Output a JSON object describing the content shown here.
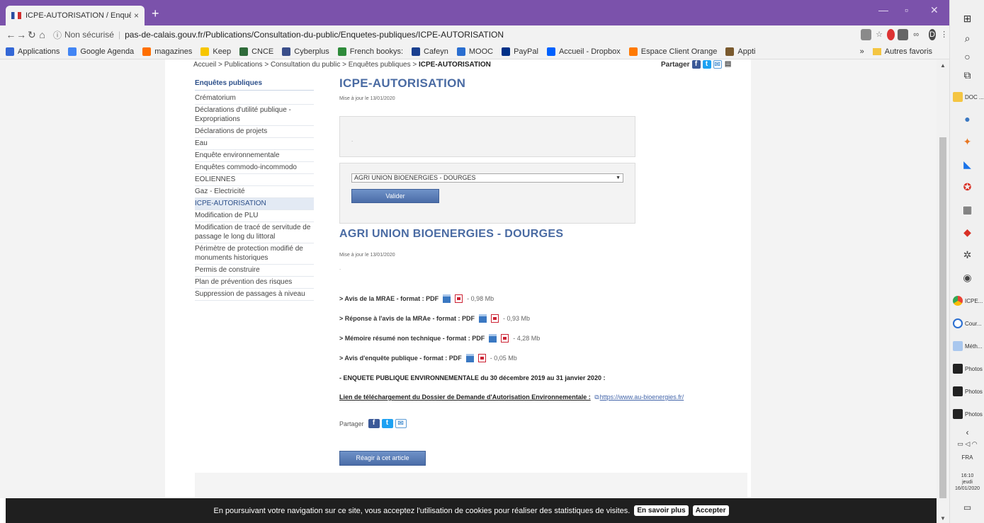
{
  "browser": {
    "tab_title": "ICPE-AUTORISATION / Enquêtes p",
    "tab_close": "×",
    "new_tab": "+",
    "address_security": "Non sécurisé",
    "address_url": "pas-de-calais.gouv.fr/Publications/Consultation-du-public/Enquetes-publiques/ICPE-AUTORISATION",
    "profile_letter": "D"
  },
  "bookmarks": {
    "items": [
      "Applications",
      "Google Agenda",
      "magazines",
      "Keep",
      "CNCE",
      "Cyberplus",
      "French bookys:",
      "Cafeyn",
      "MOOC",
      "PayPal",
      "Accueil - Dropbox",
      "Espace Client Orange",
      "Appti"
    ],
    "more": "»",
    "other": "Autres favoris"
  },
  "page": {
    "breadcrumb_trail": "Accueil > Publications > Consultation du public > Enquêtes publiques > ",
    "breadcrumb_current": "ICPE-AUTORISATION",
    "share_label": "Partager",
    "sidebar": {
      "title": "Enquêtes publiques",
      "items": [
        "Crématorium",
        "Déclarations d'utilité publique - Expropriations",
        "Déclarations de projets",
        "Eau",
        "Enquête environnementale",
        "Enquêtes commodo-incommodo",
        "EOLIENNES",
        "Gaz - Electricité",
        "ICPE-AUTORISATION",
        "Modification de PLU",
        "Modification de tracé de servitude de passage le long du littoral",
        "Périmètre de protection modifié de monuments historiques",
        "Permis de construire",
        "Plan de prévention des risques",
        "Suppression de passages à niveau"
      ],
      "active_index": 8
    },
    "heading": "ICPE-AUTORISATION",
    "updated": "Mise à jour le 13/01/2020",
    "greybox_text": ".",
    "select_value": "AGRI UNION BIOENERGIES - DOURGES",
    "select_arrow": "▼",
    "validate_label": "Valider",
    "subheading": "AGRI UNION BIOENERGIES - DOURGES",
    "updated2": "Mise à jour le 13/01/2020",
    "dot": ".",
    "documents": [
      {
        "label": "> Avis de la MRAE - format : PDF",
        "size": "- 0,98 Mb"
      },
      {
        "label": "> Réponse à l'avis de la MRAe - format : PDF",
        "size": "- 0,93 Mb"
      },
      {
        "label": "> Mémoire résumé non technique - format : PDF",
        "size": "- 4,28 Mb"
      },
      {
        "label": "> Avis d'enquête publique - format : PDF",
        "size": "- 0,05 Mb"
      }
    ],
    "enquete_text": "- ENQUETE PUBLIQUE ENVIRONNEMENTALE du 30 décembre 2019 au 31 janvier 2020 :",
    "link_label": "Lien de téléchargement du Dossier de Demande d'Autorisation Environnementale :",
    "link_url": "https://www.au-bioenergies.fr/",
    "share_bottom": "Partager",
    "react_label": "Réagir à cet article"
  },
  "cookie": {
    "text": "En poursuivant votre navigation sur ce site, vous acceptez l'utilisation de cookies pour réaliser des statistiques de visites.",
    "learn_more": "En savoir plus",
    "accept": "Accepter"
  },
  "taskbar": {
    "apps": [
      "DOC ...",
      "ICPE...",
      "Cour...",
      "Méth...",
      "Photos",
      "Photos",
      "Photos"
    ],
    "language": "FRA",
    "time": "16:10",
    "day": "jeudi",
    "date": "16/01/2020"
  }
}
